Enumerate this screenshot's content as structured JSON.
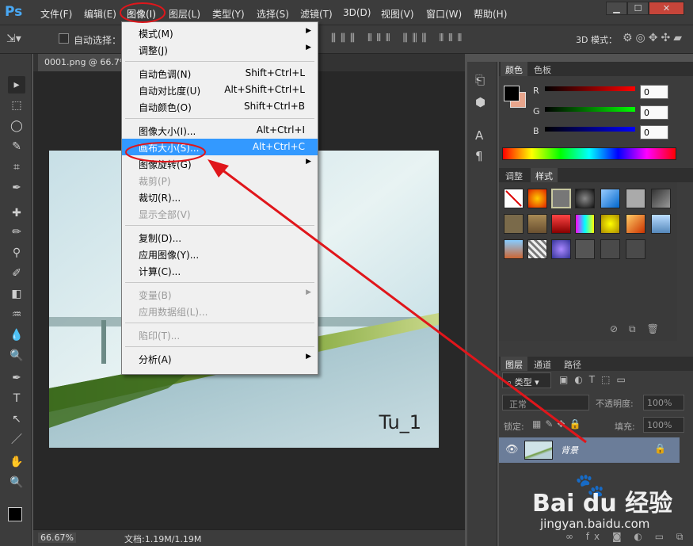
{
  "app": {
    "logo": "Ps"
  },
  "menubar": {
    "items": [
      "文件(F)",
      "编辑(E)",
      "图像(I)",
      "图层(L)",
      "类型(Y)",
      "选择(S)",
      "滤镜(T)",
      "3D(D)",
      "视图(V)",
      "窗口(W)",
      "帮助(H)"
    ],
    "window_controls": [
      "▁",
      "☐",
      "✕"
    ]
  },
  "options_bar": {
    "auto_select": "自动选择：",
    "mode_3d": "3D 模式："
  },
  "document": {
    "tab": "0001.png @ 66.7%",
    "photo_caption": "Tu_1"
  },
  "status": {
    "zoom": "66.67%",
    "doc_info": "文档:1.19M/1.19M"
  },
  "image_menu": {
    "groups": [
      [
        {
          "label": "模式(M)",
          "arrow": true
        },
        {
          "label": "调整(J)",
          "arrow": true
        }
      ],
      [
        {
          "label": "自动色调(N)",
          "shortcut": "Shift+Ctrl+L"
        },
        {
          "label": "自动对比度(U)",
          "shortcut": "Alt+Shift+Ctrl+L"
        },
        {
          "label": "自动颜色(O)",
          "shortcut": "Shift+Ctrl+B"
        }
      ],
      [
        {
          "label": "图像大小(I)...",
          "shortcut": "Alt+Ctrl+I"
        },
        {
          "label": "画布大小(S)...",
          "shortcut": "Alt+Ctrl+C",
          "highlighted": true
        },
        {
          "label": "图像旋转(G)",
          "arrow": true
        },
        {
          "label": "裁剪(P)",
          "disabled": true
        },
        {
          "label": "裁切(R)..."
        },
        {
          "label": "显示全部(V)",
          "disabled": true
        }
      ],
      [
        {
          "label": "复制(D)..."
        },
        {
          "label": "应用图像(Y)..."
        },
        {
          "label": "计算(C)..."
        }
      ],
      [
        {
          "label": "变量(B)",
          "arrow": true,
          "disabled": true
        },
        {
          "label": "应用数据组(L)...",
          "disabled": true
        }
      ],
      [
        {
          "label": "陷印(T)...",
          "disabled": true
        }
      ],
      [
        {
          "label": "分析(A)",
          "arrow": true
        }
      ]
    ]
  },
  "color_panel": {
    "tabs": [
      "颜色",
      "色板"
    ],
    "channels": [
      {
        "name": "R",
        "value": "0"
      },
      {
        "name": "G",
        "value": "0"
      },
      {
        "name": "B",
        "value": "0"
      }
    ]
  },
  "styles_panel": {
    "tabs": [
      "调整",
      "样式"
    ]
  },
  "layers_panel": {
    "tabs": [
      "图层",
      "通道",
      "路径"
    ],
    "filter": "类型",
    "blend_mode": "正常",
    "opacity_label": "不透明度:",
    "opacity": "100%",
    "lock_label": "锁定:",
    "fill_label": "填充:",
    "fill": "100%",
    "layer_name": "背景"
  },
  "watermark": {
    "brand": "Bai du 经验",
    "url": "jingyan.baidu.com"
  },
  "colors": {
    "accent": "#3399ff",
    "annotation": "#e0161b"
  }
}
